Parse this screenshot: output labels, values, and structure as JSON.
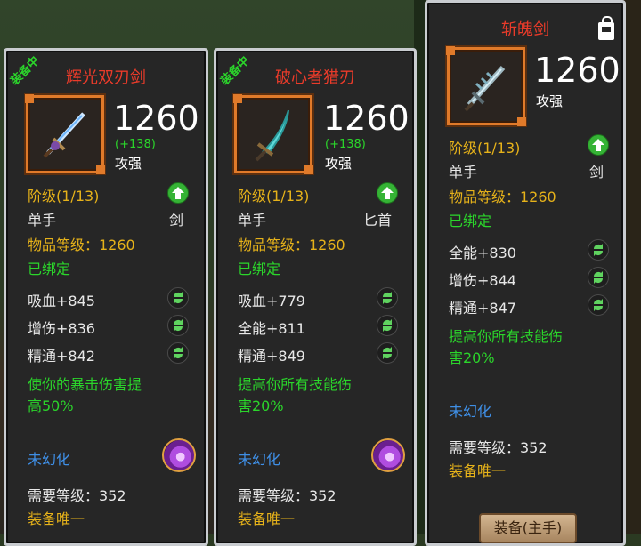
{
  "cards": [
    {
      "equipped": "装备中",
      "name": "辉光双刃剑",
      "item_level_value": "1260",
      "delta": "(+138)",
      "stat_label": "攻强",
      "tier": "阶级(1/13)",
      "hand": "单手",
      "weapon_type": "剑",
      "item_level": "物品等级：1260",
      "bound": "已绑定",
      "stats": [
        "吸血+845",
        "增伤+836",
        "精通+842"
      ],
      "effect": [
        "使你的暴击伤害提",
        "高50%"
      ],
      "illusion": "未幻化",
      "req_level": "需要等级：352",
      "unique": "装备唯一"
    },
    {
      "equipped": "装备中",
      "name": "破心者猎刃",
      "item_level_value": "1260",
      "delta": "(+138)",
      "stat_label": "攻强",
      "tier": "阶级(1/13)",
      "hand": "单手",
      "weapon_type": "匕首",
      "item_level": "物品等级：1260",
      "bound": "已绑定",
      "stats": [
        "吸血+779",
        "全能+811",
        "精通+849"
      ],
      "effect": [
        "提高你所有技能伤",
        "害20%"
      ],
      "illusion": "未幻化",
      "req_level": "需要等级：352",
      "unique": "装备唯一"
    },
    {
      "name": "斩魄剑",
      "item_level_value": "1260",
      "stat_label": "攻强",
      "tier": "阶级(1/13)",
      "hand": "单手",
      "weapon_type": "剑",
      "item_level": "物品等级：1260",
      "bound": "已绑定",
      "stats": [
        "全能+830",
        "增伤+844",
        "精通+847"
      ],
      "effect": [
        "提高你所有技能伤",
        "害20%"
      ],
      "illusion": "未幻化",
      "req_level": "需要等级：352",
      "unique": "装备唯一",
      "equip_button": "装备(主手)"
    }
  ],
  "colors": {
    "title_red": "#ea3b2a",
    "gold": "#e6b21a",
    "green": "#2bd52b",
    "blue": "#3f8fe6",
    "frame_orange": "#e07a2a"
  },
  "icons": [
    "sword-icon",
    "dagger-icon",
    "upgrade-arrow-icon",
    "reforge-cycle-icon",
    "transmog-orb-icon",
    "lock-icon"
  ]
}
